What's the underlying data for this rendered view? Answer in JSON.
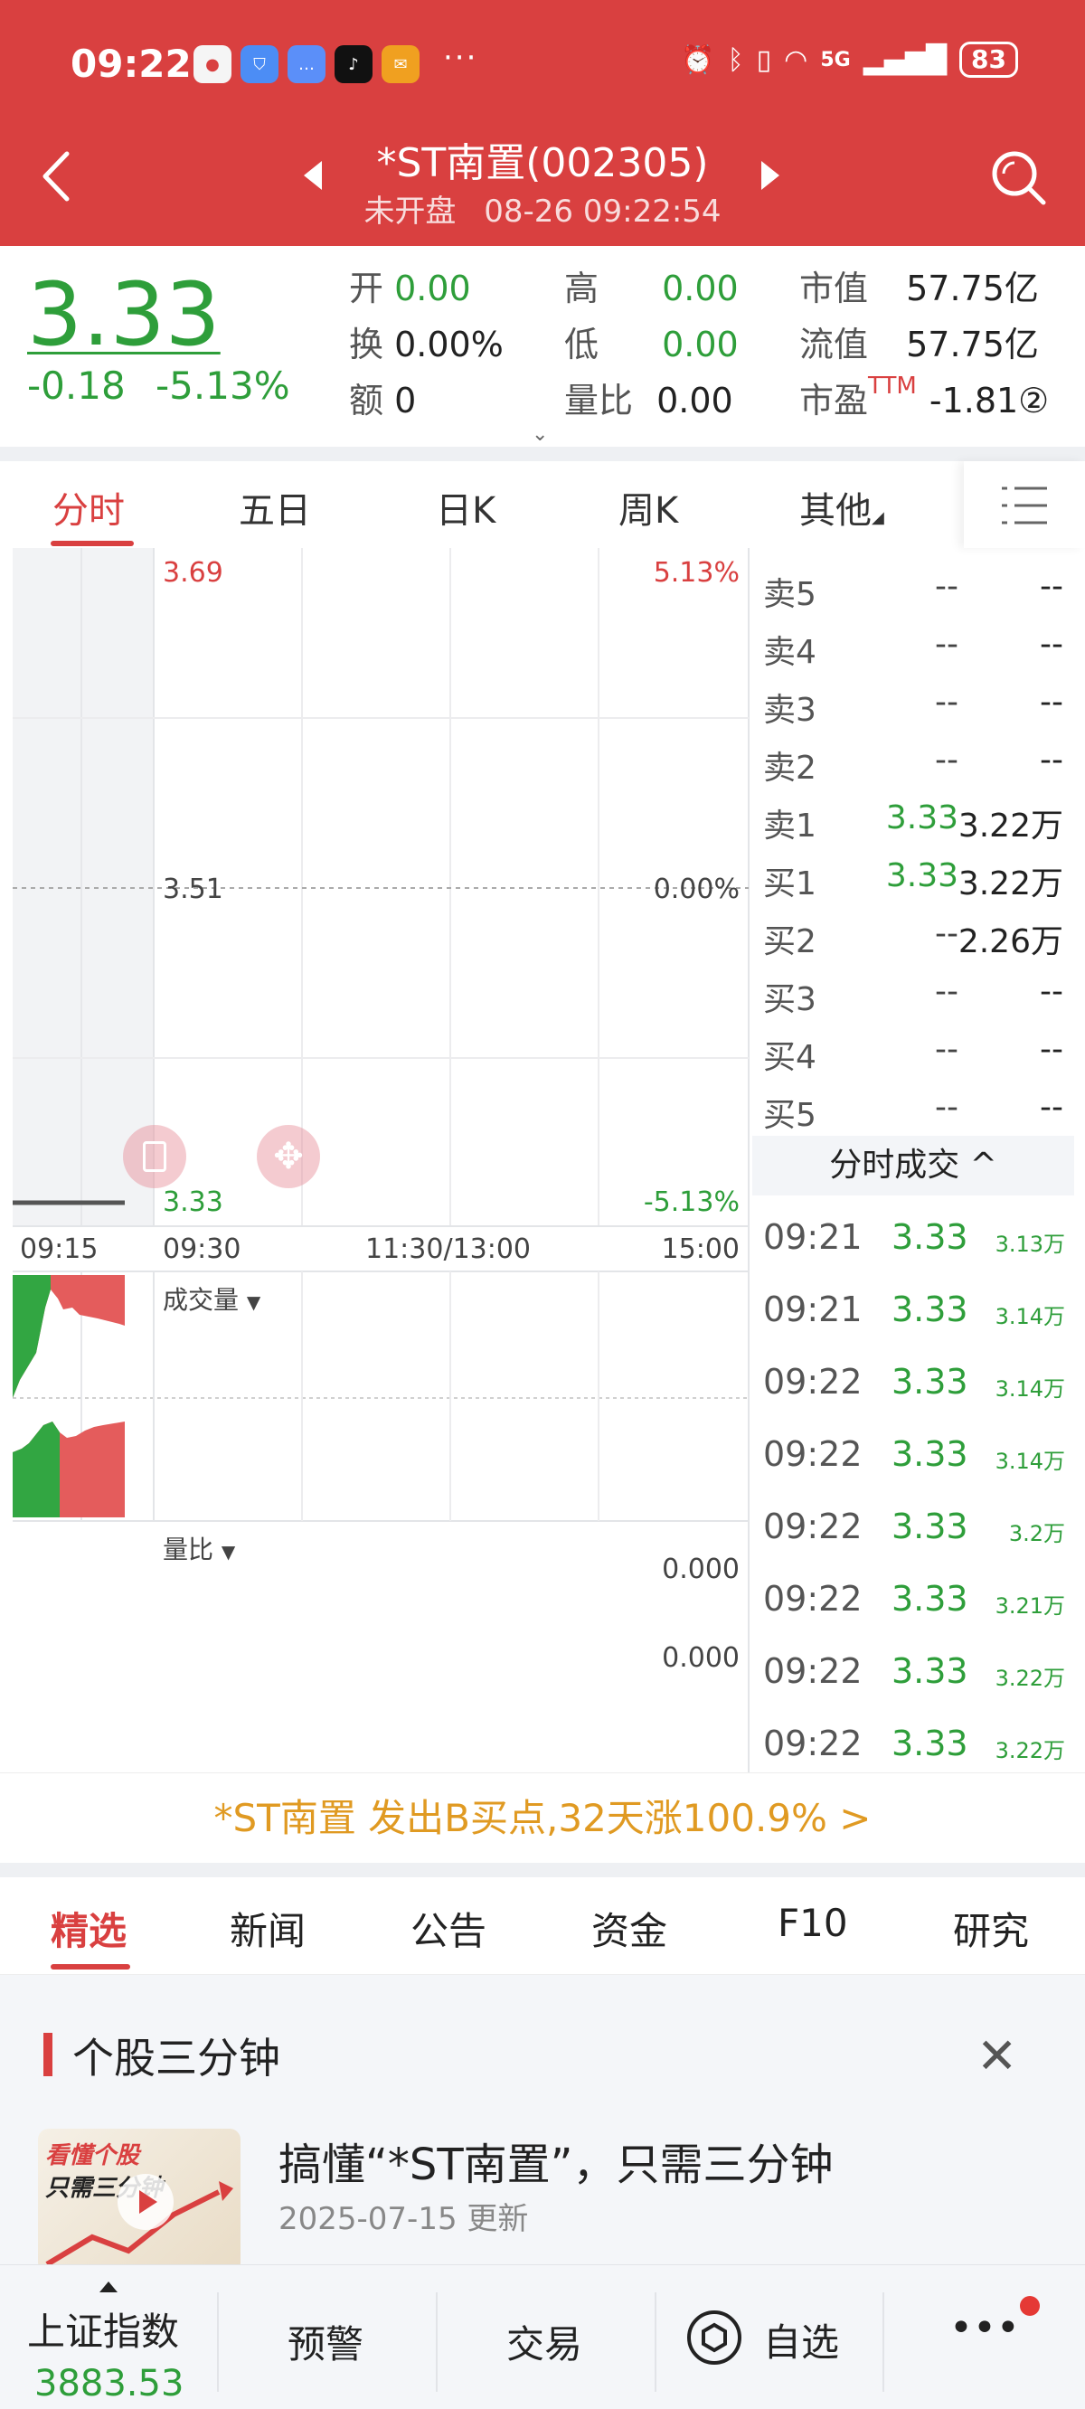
{
  "status_bar": {
    "time": "09:22",
    "more": "···",
    "network": "5G",
    "battery": "83"
  },
  "header": {
    "stock_name": "*ST南置(002305)",
    "status": "未开盘",
    "datetime": "08-26 09:22:54"
  },
  "quote": {
    "price": "3.33",
    "change": "-0.18",
    "change_pct": "-5.13%",
    "open_label": "开",
    "open_value": "0.00",
    "turnover_label": "换",
    "turnover_value": "0.00%",
    "amount_label": "额",
    "amount_value": "0",
    "high_label": "高",
    "high_value": "0.00",
    "low_label": "低",
    "low_value": "0.00",
    "vol_ratio_label": "量比",
    "vol_ratio_value": "0.00",
    "mcap_label": "市值",
    "mcap_value": "57.75亿",
    "float_label": "流值",
    "float_value": "57.75亿",
    "pe_label": "市盈",
    "pe_ttm": "TTM",
    "pe_value": "-1.81②"
  },
  "chart_tabs": [
    "分时",
    "五日",
    "日K",
    "周K",
    "其他"
  ],
  "chart": {
    "price_high": "3.69",
    "pct_high": "5.13%",
    "price_mid": "3.51",
    "pct_mid": "0.00%",
    "price_low": "3.33",
    "pct_low": "-5.13%",
    "time_labels": [
      "09:15",
      "09:30",
      "11:30/13:00",
      "15:00"
    ],
    "volume_label": "成交量",
    "ratio_label": "量比",
    "ratio_value_1": "0.000",
    "ratio_value_2": "0.000"
  },
  "order_book": [
    {
      "label": "卖5",
      "price": "--",
      "volume": "--"
    },
    {
      "label": "卖4",
      "price": "--",
      "volume": "--"
    },
    {
      "label": "卖3",
      "price": "--",
      "volume": "--"
    },
    {
      "label": "卖2",
      "price": "--",
      "volume": "--"
    },
    {
      "label": "卖1",
      "price": "3.33",
      "volume": "3.22万"
    },
    {
      "label": "买1",
      "price": "3.33",
      "volume": "3.22万"
    },
    {
      "label": "买2",
      "price": "--",
      "volume": "2.26万"
    },
    {
      "label": "买3",
      "price": "--",
      "volume": "--"
    },
    {
      "label": "买4",
      "price": "--",
      "volume": "--"
    },
    {
      "label": "买5",
      "price": "--",
      "volume": "--"
    }
  ],
  "trades_header": "分时成交 ^",
  "trades": [
    {
      "time": "09:21",
      "price": "3.33",
      "volume": "3.13万"
    },
    {
      "time": "09:21",
      "price": "3.33",
      "volume": "3.14万"
    },
    {
      "time": "09:22",
      "price": "3.33",
      "volume": "3.14万"
    },
    {
      "time": "09:22",
      "price": "3.33",
      "volume": "3.14万"
    },
    {
      "time": "09:22",
      "price": "3.33",
      "volume": "3.2万"
    },
    {
      "time": "09:22",
      "price": "3.33",
      "volume": "3.21万"
    },
    {
      "time": "09:22",
      "price": "3.33",
      "volume": "3.22万"
    },
    {
      "time": "09:22",
      "price": "3.33",
      "volume": "3.22万"
    }
  ],
  "signal_banner": "*ST南置 发出B买点,32天涨100.9% >",
  "content_tabs": [
    "精选",
    "新闻",
    "公告",
    "资金",
    "F10",
    "研究"
  ],
  "card": {
    "title": "个股三分钟",
    "thumb_text_1": "看懂个股",
    "thumb_text_2": "只需三分钟",
    "article_title": "搞懂“*ST南置”，只需三分钟",
    "article_date": "2025-07-15 更新"
  },
  "bottom_bar": {
    "index_name": "上证指数",
    "index_value": "3883.53",
    "alert": "预警",
    "trade": "交易",
    "watchlist": "自选",
    "more": "•••"
  },
  "colors": {
    "brand_red": "#d94040",
    "down_green": "#2e9e3a",
    "signal_orange": "#e09a22"
  }
}
